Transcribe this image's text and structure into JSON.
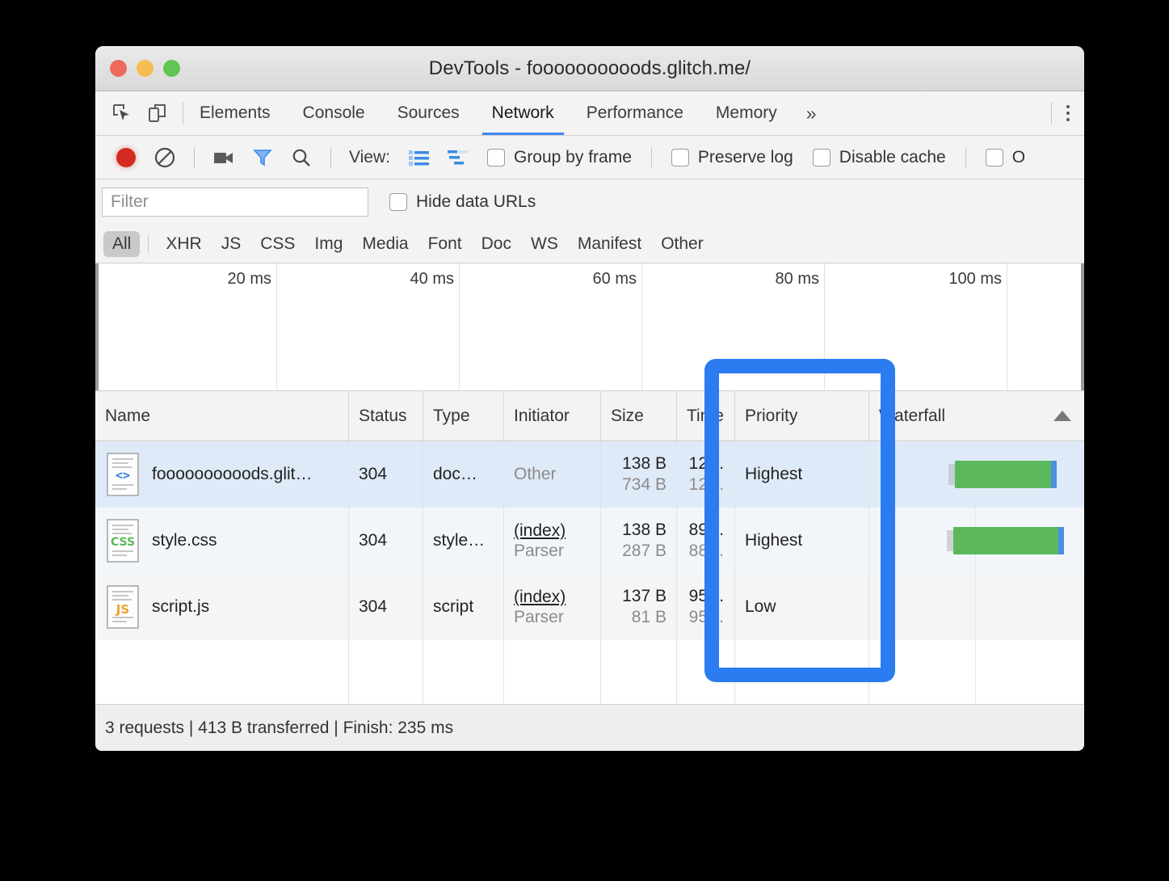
{
  "window": {
    "title": "DevTools - foooooooooods.glitch.me/",
    "traffic_lights": [
      "close",
      "minimize",
      "zoom"
    ]
  },
  "tabbar": {
    "icons": [
      {
        "name": "inspect-element-icon"
      },
      {
        "name": "device-toolbar-icon"
      }
    ],
    "tabs": [
      {
        "label": "Elements",
        "active": false
      },
      {
        "label": "Console",
        "active": false
      },
      {
        "label": "Sources",
        "active": false
      },
      {
        "label": "Network",
        "active": true
      },
      {
        "label": "Performance",
        "active": false
      },
      {
        "label": "Memory",
        "active": false
      }
    ],
    "more_label": "»",
    "menu_icon": "kebab-menu-icon"
  },
  "network_toolbar": {
    "record_icon": "record-button-icon",
    "clear_icon": "clear-icon",
    "capture_screenshots_icon": "camera-icon",
    "filter_icon": "filter-funnel-icon",
    "search_icon": "search-icon",
    "view_label": "View:",
    "view_list_icon": "list-view-icon",
    "view_waterfall_icon": "waterfall-view-icon",
    "checkboxes": [
      {
        "label": "Group by frame",
        "checked": false
      },
      {
        "label": "Preserve log",
        "checked": false
      },
      {
        "label": "Disable cache",
        "checked": false
      },
      {
        "label": "O",
        "checked": false
      }
    ]
  },
  "filter_bar": {
    "placeholder": "Filter",
    "value": "",
    "hide_data_urls_label": "Hide data URLs",
    "hide_data_urls_checked": false
  },
  "type_chips": [
    {
      "label": "All",
      "active": true
    },
    {
      "label": "XHR",
      "active": false
    },
    {
      "label": "JS",
      "active": false
    },
    {
      "label": "CSS",
      "active": false
    },
    {
      "label": "Img",
      "active": false
    },
    {
      "label": "Media",
      "active": false
    },
    {
      "label": "Font",
      "active": false
    },
    {
      "label": "Doc",
      "active": false
    },
    {
      "label": "WS",
      "active": false
    },
    {
      "label": "Manifest",
      "active": false
    },
    {
      "label": "Other",
      "active": false
    }
  ],
  "overview": {
    "ticks": [
      "20 ms",
      "40 ms",
      "60 ms",
      "80 ms",
      "100 ms"
    ]
  },
  "table": {
    "columns": [
      "Name",
      "Status",
      "Type",
      "Initiator",
      "Size",
      "Time",
      "Priority",
      "Waterfall"
    ],
    "sort_indicator": "ascending-triangle",
    "rows": [
      {
        "icon": "document-file-icon",
        "name": "foooooooooods.glit…",
        "status": "304",
        "type": "doc…",
        "initiator": "Other",
        "initiator_sub": "",
        "initiator_is_link": false,
        "size": "138 B",
        "size_sub": "734 B",
        "time": "12…",
        "time_sub": "12…",
        "priority": "Highest",
        "selected": true
      },
      {
        "icon": "css-file-icon",
        "name": "style.css",
        "status": "304",
        "type": "style…",
        "initiator": "(index)",
        "initiator_sub": "Parser",
        "initiator_is_link": true,
        "size": "138 B",
        "size_sub": "287 B",
        "time": "89…",
        "time_sub": "88…",
        "priority": "Highest",
        "selected": false
      },
      {
        "icon": "js-file-icon",
        "name": "script.js",
        "status": "304",
        "type": "script",
        "initiator": "(index)",
        "initiator_sub": "Parser",
        "initiator_is_link": true,
        "size": "137 B",
        "size_sub": "81 B",
        "time": "95…",
        "time_sub": "95…",
        "priority": "Low",
        "selected": false
      }
    ]
  },
  "footer": {
    "summary": "3 requests | 413 B transferred | Finish: 235 ms"
  },
  "callout": {
    "name": "priority-column-highlight",
    "color": "#2b7cf0"
  },
  "colors": {
    "accent": "#4285f4",
    "waterfall_bar": "#5cb85c",
    "record": "#d32b20",
    "selected_row": "#dfeaf8"
  }
}
